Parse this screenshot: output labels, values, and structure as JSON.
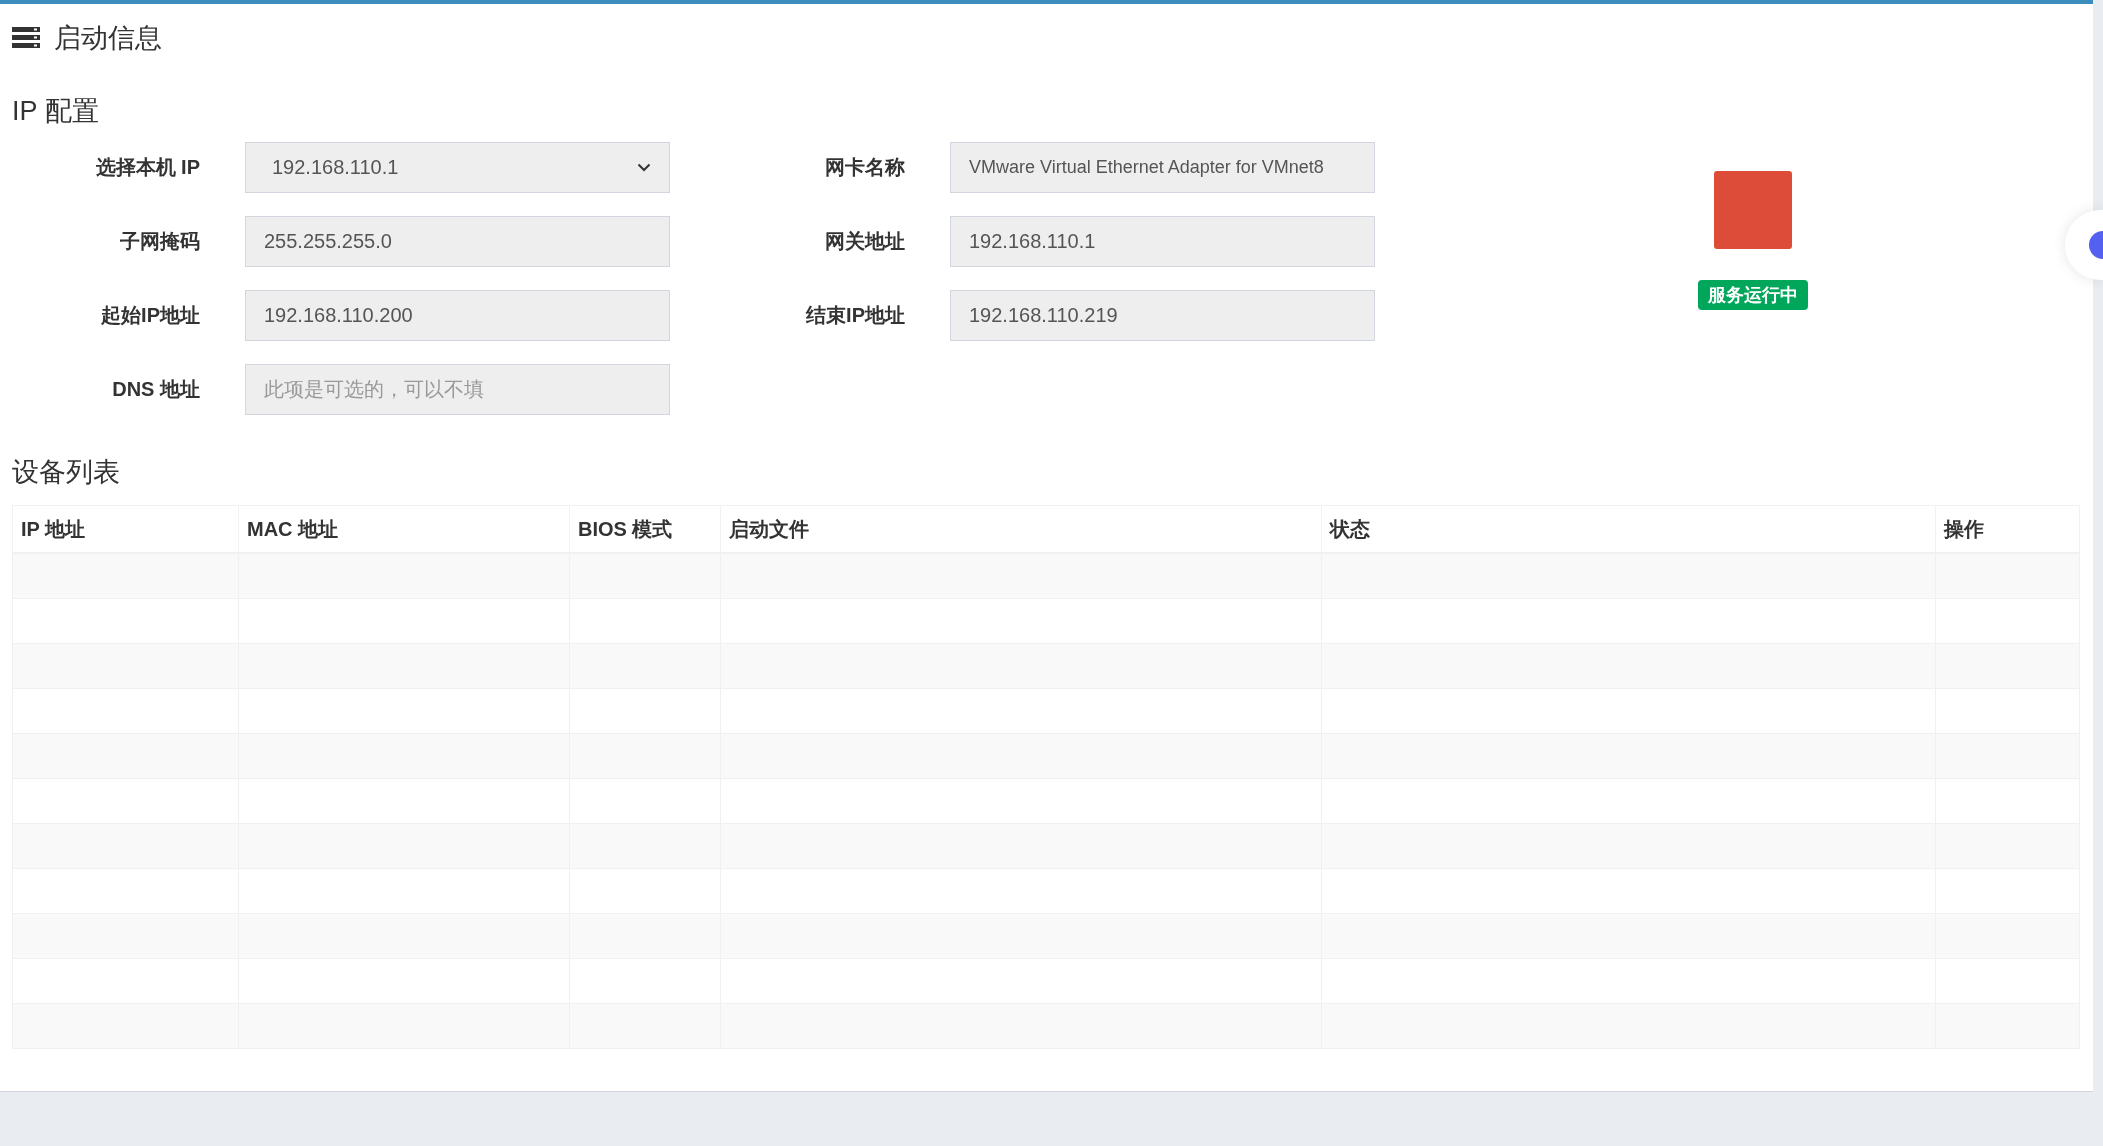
{
  "header": {
    "title": "启动信息"
  },
  "ip_config": {
    "title": "IP 配置",
    "fields": [
      {
        "label": "选择本机 IP",
        "kind": "select",
        "value": "192.168.110.1"
      },
      {
        "label": "网卡名称",
        "kind": "input",
        "value": "VMware Virtual Ethernet Adapter for VMnet8"
      },
      {
        "label": "子网掩码",
        "kind": "input",
        "value": "255.255.255.0"
      },
      {
        "label": "网关地址",
        "kind": "input",
        "value": "192.168.110.1"
      },
      {
        "label": "起始IP地址",
        "kind": "input",
        "value": "192.168.110.200"
      },
      {
        "label": "结束IP地址",
        "kind": "input",
        "value": "192.168.110.219"
      },
      {
        "label": "DNS 地址",
        "kind": "input",
        "placeholder": "此项是可选的，可以不填"
      }
    ]
  },
  "service": {
    "running": true,
    "status": "服务运行中"
  },
  "device_list": {
    "title": "设备列表",
    "columns": [
      "IP 地址",
      "MAC 地址",
      "BIOS 模式",
      "启动文件",
      "状态",
      "操作"
    ]
  }
}
